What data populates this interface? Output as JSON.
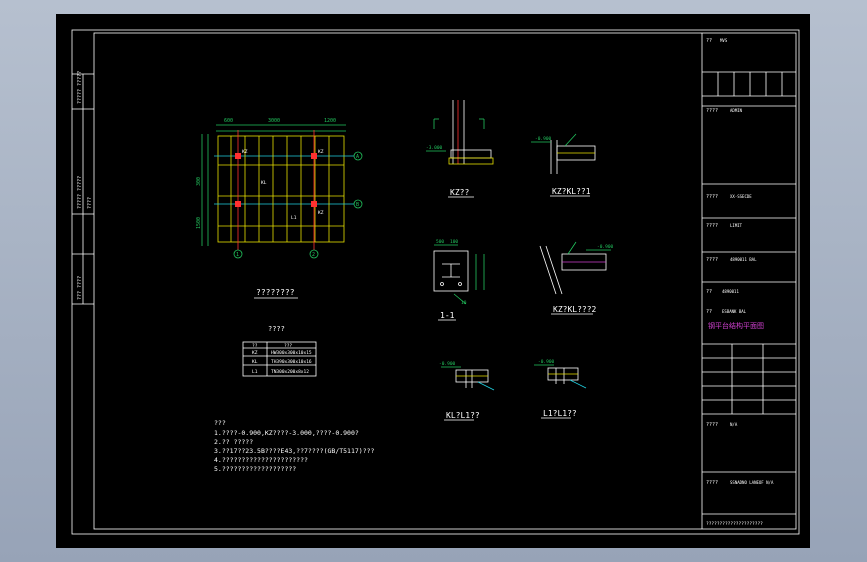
{
  "plan": {
    "title": "????????",
    "dims_top": [
      "600",
      "3000",
      "1200"
    ],
    "dims_left": [
      "300",
      "1500"
    ],
    "axes_rows": [
      "A",
      "B"
    ],
    "axes_cols": [
      "1",
      "2"
    ],
    "labels": [
      "KZ",
      "KL",
      "L1",
      "KZ",
      "KZ"
    ]
  },
  "details": {
    "kz": {
      "title": "KZ??",
      "level": "-3.000"
    },
    "kz_kl1": {
      "title": "KZ?KL??1",
      "level": "-0.900"
    },
    "section11": {
      "title": "1-1",
      "d1": "500",
      "d2": "100",
      "d3": "10"
    },
    "kz_kl2": {
      "title": "KZ?KL???2",
      "level": "-0.900"
    },
    "kl_l1": {
      "title": "KL?L1??",
      "level": "-0.900"
    },
    "l1_l1": {
      "title": "L1?L1??",
      "level": "-0.900"
    }
  },
  "table": {
    "title": "????",
    "headers": [
      "??",
      "???"
    ],
    "rows": [
      [
        "KZ",
        "HW300x300x10x15"
      ],
      [
        "KL",
        "TH390x300x10x16"
      ],
      [
        "L1",
        "TN300x200x8x12"
      ]
    ]
  },
  "notes": {
    "title": "???",
    "lines": [
      "1.????-0.900,KZ????-3.000,????-0.900?",
      "2.??   ?????",
      "3.??17??23.5B????E43,??7????(GB/T5117)???",
      "4.??????????????????????",
      "5.???????????????????"
    ]
  },
  "title_block": {
    "rows": [
      {
        "label": "??",
        "value": "MVS"
      },
      {
        "label": "????",
        "value": "ADMIN"
      },
      {
        "label": "????",
        "value": "XX-SSECDE"
      },
      {
        "label": "????",
        "value": "LIMIT"
      },
      {
        "label": "????",
        "value": "4890011 BAL"
      },
      {
        "label": "??",
        "value": "4890011"
      },
      {
        "label": "??",
        "value": "ESBANK BAL"
      },
      {
        "label": "????",
        "value": "N/A"
      },
      {
        "label": "????",
        "value": "SSNADNO LANEOF N/A"
      }
    ],
    "drawing_name": "钢平台结构平面图",
    "footer": "?????????????????????"
  },
  "side_stamps": [
    "????? ?????",
    "????? ?????",
    "????",
    "??? ????"
  ],
  "colors": {
    "line": "#ffffff",
    "green": "#22c55e",
    "yellow": "#e8e000",
    "red": "#ff3030",
    "cyan": "#20d0e0",
    "magenta": "#d040d0"
  }
}
